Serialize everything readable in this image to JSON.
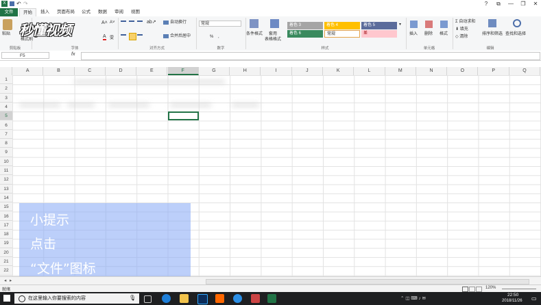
{
  "window": {
    "document_title": "",
    "controls": [
      "?",
      "⧉",
      "—",
      "❐",
      "✕"
    ]
  },
  "ribbon_tabs": [
    "文件",
    "开始",
    "插入",
    "页面布局",
    "公式",
    "数据",
    "审阅",
    "视图"
  ],
  "ribbon": {
    "paste": "粘贴",
    "format_painter": "格式刷",
    "clipboard": "剪贴板",
    "font": "字体",
    "wrap_text": "自动换行",
    "merge_center": "合并后居中",
    "alignment": "对齐方式",
    "number_format": "常规",
    "number": "数字",
    "conditional_format": "条件格式",
    "table_format": "套用\n表格格式",
    "styles": "样式",
    "style_cells": [
      {
        "label": "着色 3",
        "color": "#a5a5a5"
      },
      {
        "label": "着色 4",
        "color": "#ffc000"
      },
      {
        "label": "着色 5",
        "color": "#5b6c9b"
      },
      {
        "label": "着色 6",
        "color": "#3a8a5e"
      },
      {
        "label": "常规",
        "color": "#ffffff"
      },
      {
        "label": "差",
        "color": "#ffc7ce"
      }
    ],
    "insert": "插入",
    "delete": "删除",
    "format": "格式",
    "cells": "单元格",
    "autosum": "自动求和",
    "fill": "填充",
    "clear": "清除",
    "sort_filter": "排序和筛选",
    "find_select": "查找和选择",
    "editing": "编辑"
  },
  "formula_bar": {
    "name_box": "F5",
    "fx": "fx"
  },
  "columns": [
    "A",
    "B",
    "C",
    "D",
    "E",
    "F",
    "G",
    "H",
    "I",
    "J",
    "K",
    "L",
    "M",
    "N",
    "O",
    "P",
    "Q"
  ],
  "selected_column": "F",
  "rows": [
    "1",
    "2",
    "3",
    "4",
    "5",
    "6",
    "7",
    "8",
    "9",
    "10",
    "11",
    "12",
    "13",
    "14",
    "15",
    "16",
    "17",
    "18",
    "19",
    "20",
    "21",
    "22"
  ],
  "selected_row": "5",
  "logo_text": "秒懂视频",
  "overlay": {
    "line1": "小提示",
    "line2": "点击",
    "line3": "“文件”图标"
  },
  "sheet_tabs": [
    "",
    ""
  ],
  "status": {
    "ready": "就绪",
    "zoom": "120%"
  },
  "taskbar": {
    "search_placeholder": "在这里输入你要搜索的内容",
    "time": "22:50",
    "date": "2018/11/26"
  }
}
